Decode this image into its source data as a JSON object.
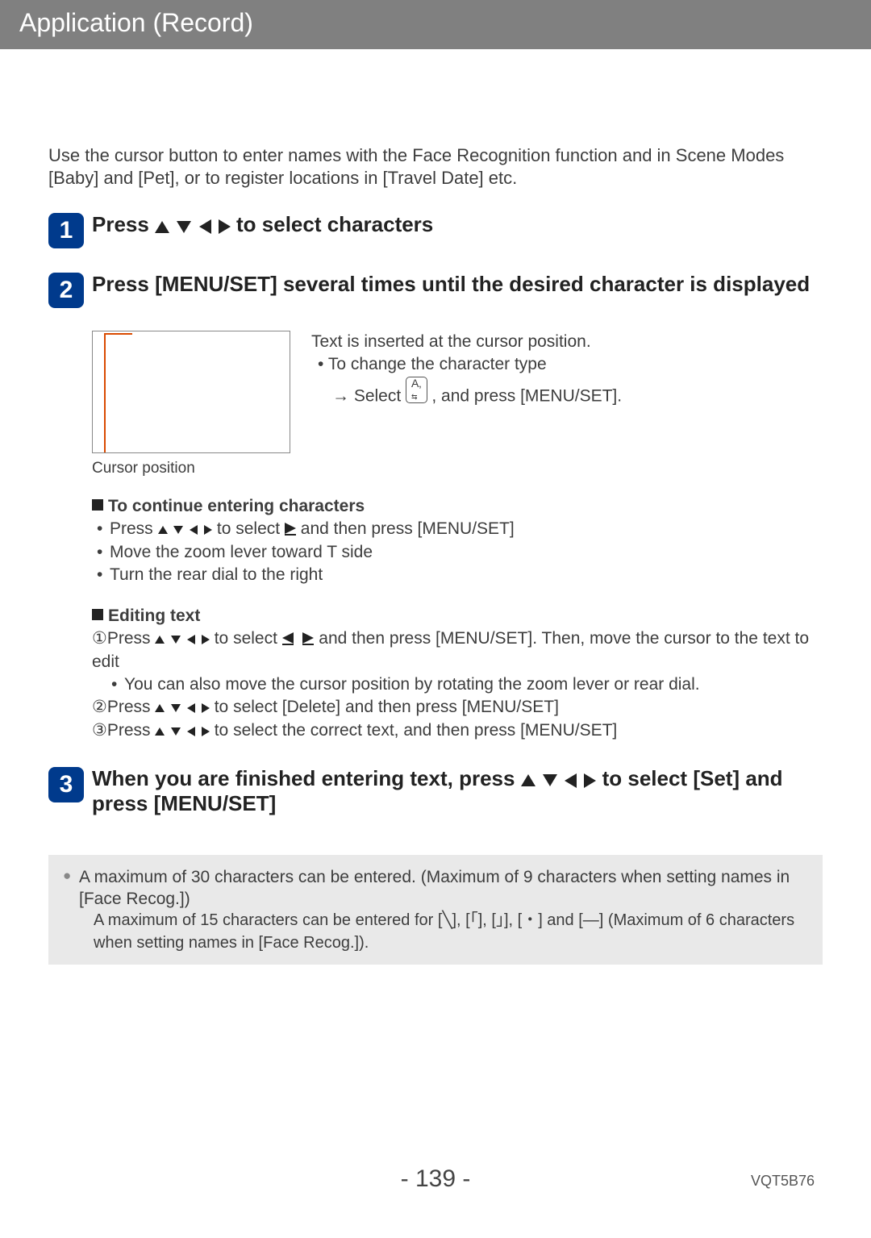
{
  "header": {
    "title": "Application (Record)"
  },
  "intro": "Use the cursor button to enter names with the Face Recognition function and in Scene Modes [Baby] and [Pet], or to register locations in [Travel Date] etc.",
  "steps": {
    "s1": {
      "num": "1",
      "pre": "Press ",
      "post": " to select characters"
    },
    "s2": {
      "num": "2",
      "text": "Press [MENU/SET] several times until the desired character is displayed"
    },
    "s3": {
      "num": "3",
      "pre": "When you are finished entering text, press ",
      "post": " to select [Set] and press [MENU/SET]"
    }
  },
  "fig": {
    "label": "Cursor position",
    "side1": "Text is inserted at the cursor position.",
    "side2": "To change the character type",
    "side3a": "→ Select ",
    "side3b": ", and press [MENU/SET]."
  },
  "cont": {
    "head": "To continue entering characters",
    "a_pre": "Press ",
    "a_mid": " to select ",
    "a_post": " and then press [MENU/SET]",
    "b": "Move the zoom lever toward T side",
    "c": "Turn the rear dial to the right"
  },
  "edit": {
    "head": "Editing text",
    "l1_pre": "Press ",
    "l1_mid": " to select ",
    "l1_post": " and then press [MENU/SET]. Then, move the cursor to the text to edit",
    "l1_note": "You can also move the cursor position by rotating the zoom lever or rear dial.",
    "l2_pre": "Press ",
    "l2_post": " to select [Delete] and then press [MENU/SET]",
    "l3_pre": "Press ",
    "l3_post": " to select the correct text, and then press [MENU/SET]"
  },
  "note": {
    "main": "A maximum of 30 characters can be entered. (Maximum of 9 characters when setting names in [Face Recog.])",
    "sub_a": "A maximum of 15 characters can be entered for [",
    "sub_b": "], [",
    "sub_c": "] and [",
    "sub_d": "] (Maximum of 6 characters when setting names in [Face Recog.])."
  },
  "footer": {
    "page": "- 139 -",
    "code": "VQT5B76"
  }
}
